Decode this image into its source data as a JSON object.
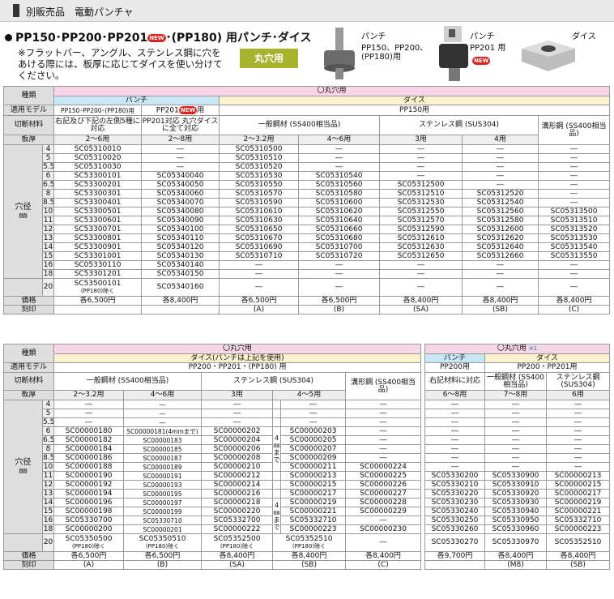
{
  "header": {
    "label": "別販売品　電動パンチャ"
  },
  "title": {
    "main": "PP150･PP200･PP201",
    "new": "NEW",
    "tail": "･(PP180) 用パンチ･ダイス"
  },
  "note": "※フラットバー、アングル、ステンレス鋼に穴をあける際には、板厚に応じてダイスを使い分けてください。",
  "badge": "丸穴用",
  "products": [
    {
      "label": "パンチ",
      "sub": "PP150、PP200、(PP180)用"
    },
    {
      "label": "パンチ",
      "sub": "PP201 用",
      "new": "NEW"
    },
    {
      "label": "ダイス",
      "sub": ""
    }
  ],
  "t1": {
    "kind": "種類",
    "round": "〇丸穴用",
    "punch": "パンチ",
    "die": "ダイス",
    "model": "適用モデル",
    "m_pp150": "PP150･PP200･(PP180)用",
    "m_pp201": "PP201",
    "m_new": "NEW",
    "m_yo": "用",
    "m_die": "PP150用",
    "material": "切断材料",
    "mat_a": "右記及び下記の左側5種に対応",
    "mat_b": "PP201対応 丸穴ダイスに全て対応",
    "mat_c": "一般鋼材 (SS400相当品)",
    "mat_d": "ステンレス鋼 (SUS304)",
    "mat_e": "溝形鋼 (SS400相当品)",
    "thick": "板厚",
    "th": [
      "2～6用",
      "2～8用",
      "2～3.2用",
      "4～6用",
      "3用",
      "4用"
    ],
    "hole": "穴径",
    "unit": "㎜",
    "rows": [
      [
        "4",
        "SC05310010",
        "―",
        "SC05310500",
        "―",
        "―",
        "―",
        "―"
      ],
      [
        "5",
        "SC05310020",
        "―",
        "SC05310510",
        "―",
        "―",
        "―",
        "―"
      ],
      [
        "5.5",
        "SC05310030",
        "―",
        "SC05310520",
        "―",
        "―",
        "―",
        "―"
      ],
      [
        "6",
        "SC53300101",
        "SC05340040",
        "SC05310530",
        "SC05310540",
        "―",
        "―",
        "―"
      ],
      [
        "6.5",
        "SC53300201",
        "SC05340050",
        "SC05310550",
        "SC05310560",
        "SC05312500",
        "―",
        "―"
      ],
      [
        "8",
        "SC53300301",
        "SC05340060",
        "SC05310570",
        "SC05310580",
        "SC05312510",
        "SC05312520",
        "―"
      ],
      [
        "8.5",
        "SC53300401",
        "SC05340070",
        "SC05310590",
        "SC05310600",
        "SC05312530",
        "SC05312540",
        "―"
      ],
      [
        "10",
        "SC53300501",
        "SC05340080",
        "SC05310610",
        "SC05310620",
        "SC05312550",
        "SC05312560",
        "SC05313500"
      ],
      [
        "11",
        "SC53300601",
        "SC05340090",
        "SC05310630",
        "SC05310640",
        "SC05312570",
        "SC05312580",
        "SC05313510"
      ],
      [
        "12",
        "SC53300701",
        "SC05340100",
        "SC05310650",
        "SC05310660",
        "SC05312590",
        "SC05312600",
        "SC05313520"
      ],
      [
        "13",
        "SC53300801",
        "SC05340110",
        "SC05310670",
        "SC05310680",
        "SC05312610",
        "SC05312620",
        "SC05313530"
      ],
      [
        "14",
        "SC53300901",
        "SC05340120",
        "SC05310690",
        "SC05310700",
        "SC05312630",
        "SC05312640",
        "SC05313540"
      ],
      [
        "15",
        "SC53301001",
        "SC05340130",
        "SC05310710",
        "SC05310720",
        "SC05312650",
        "SC05312660",
        "SC05313550"
      ],
      [
        "16",
        "SC05330110",
        "SC05340140",
        "―",
        "―",
        "―",
        "―",
        "―"
      ],
      [
        "18",
        "SC53301201",
        "SC05340150",
        "―",
        "―",
        "―",
        "―",
        "―"
      ]
    ],
    "r20_a": "SC53500101",
    "r20_a2": "(PP180)除く",
    "r20_b": "SC05340160",
    "price": "価格",
    "prices": [
      "各6,500円",
      "各8,400円",
      "各6,500円",
      "各6,500円",
      "各8,400円",
      "各8,400円",
      "各8,400円"
    ],
    "mark": "刻印",
    "marks": [
      "",
      "",
      "(A)",
      "(B)",
      "(SA)",
      "(SB)",
      "(C)"
    ]
  },
  "t2": {
    "kind": "種類",
    "round": "〇丸穴用",
    "die": "ダイス(パンチは上記を使用)",
    "model": "適用モデル",
    "m": "PP200・PP201・(PP180) 用",
    "material": "切断材料",
    "mat_a": "一般鋼材 (SS400相当品)",
    "mat_b": "ステンレス鋼 (SUS304)",
    "mat_c": "溝形鋼 (SS400相当品)",
    "thick": "板厚",
    "th": [
      "2～3.2用",
      "4～6用",
      "3用",
      "4～5用"
    ],
    "mm4": "4㎜まで",
    "rows": [
      [
        "4",
        "―",
        "―",
        "―",
        "―",
        "―"
      ],
      [
        "5",
        "―",
        "―",
        "―",
        "―",
        "―"
      ],
      [
        "5.5",
        "―",
        "―",
        "―",
        "―",
        "―"
      ],
      [
        "6",
        "SC00000180",
        "SC00000181(4mmまで)",
        "SC00000202",
        "SC00000203",
        "―"
      ],
      [
        "6.5",
        "SC00000182",
        "SC00000183",
        "SC00000204",
        "SC00000205",
        "―"
      ],
      [
        "8",
        "SC00000184",
        "SC00000185",
        "SC00000206",
        "SC00000207",
        "―"
      ],
      [
        "8.5",
        "SC00000186",
        "SC00000187",
        "SC00000208",
        "SC00000209",
        "―"
      ],
      [
        "10",
        "SC00000188",
        "SC00000189",
        "SC00000210",
        "SC00000211",
        "SC00000224"
      ],
      [
        "11",
        "SC00000190",
        "SC00000191",
        "SC00000212",
        "SC00000213",
        "SC00000225"
      ],
      [
        "12",
        "SC00000192",
        "SC00000193",
        "SC00000214",
        "SC00000215",
        "SC00000226"
      ],
      [
        "13",
        "SC00000194",
        "SC00000195",
        "SC00000216",
        "SC00000217",
        "SC00000227"
      ],
      [
        "14",
        "SC00000196",
        "SC00000197",
        "SC00000218",
        "SC00000219",
        "SC00000228"
      ],
      [
        "15",
        "SC00000198",
        "SC00000199",
        "SC00000220",
        "SC00000221",
        "SC00000229"
      ],
      [
        "16",
        "SC05330700",
        "SC05330710",
        "SC05332700",
        "SC05332710",
        "―"
      ],
      [
        "18",
        "SC00000200",
        "SC00000201",
        "SC00000222",
        "SC00000223",
        "SC00000230"
      ]
    ],
    "r20": [
      "SC05350500",
      "SC05350510",
      "SC05352500",
      "SC05352510"
    ],
    "r20_note": "(PP180)除く",
    "price": "価格",
    "prices": [
      "各6,500円",
      "各6,500円",
      "各8,400円",
      "各8,400円",
      "各8,400円"
    ],
    "mark": "刻印",
    "marks": [
      "(A)",
      "(B)",
      "(SA)",
      "(SB)",
      "(C)"
    ]
  },
  "t3": {
    "round": "〇丸穴用",
    "note": "※1",
    "punch": "パンチ",
    "die": "ダイス",
    "m_punch": "PP200用",
    "m_die": "PP200・PP201用",
    "mat_a": "右記材料に対応",
    "mat_b": "一般鋼材 (SS400相当品)",
    "mat_c": "ステンレス鋼 (SUS304)",
    "th": [
      "6～8用",
      "7～8用",
      "6用"
    ],
    "rows": [
      [
        "―",
        "―",
        "―"
      ],
      [
        "―",
        "―",
        "―"
      ],
      [
        "―",
        "―",
        "―"
      ],
      [
        "―",
        "―",
        "―"
      ],
      [
        "―",
        "―",
        "―"
      ],
      [
        "―",
        "―",
        "―"
      ],
      [
        "―",
        "―",
        "―"
      ],
      [
        "―",
        "―",
        "―"
      ],
      [
        "SC05330200",
        "SC05330900",
        "SC00000213"
      ],
      [
        "SC05330210",
        "SC05330910",
        "SC00000215"
      ],
      [
        "SC05330220",
        "SC05330920",
        "SC00000217"
      ],
      [
        "SC05330230",
        "SC05330930",
        "SC00000219"
      ],
      [
        "SC05330240",
        "SC05330940",
        "SC00000221"
      ],
      [
        "SC05330250",
        "SC05330950",
        "SC05332710"
      ],
      [
        "SC05330260",
        "SC05330960",
        "SC00000223"
      ]
    ],
    "r20": [
      "SC05330270",
      "SC05330970",
      "SC05352510"
    ],
    "prices": [
      "各9,700円",
      "各8,400円",
      "各8,400円"
    ],
    "marks": [
      "",
      "(M8)",
      "(SB)"
    ]
  }
}
